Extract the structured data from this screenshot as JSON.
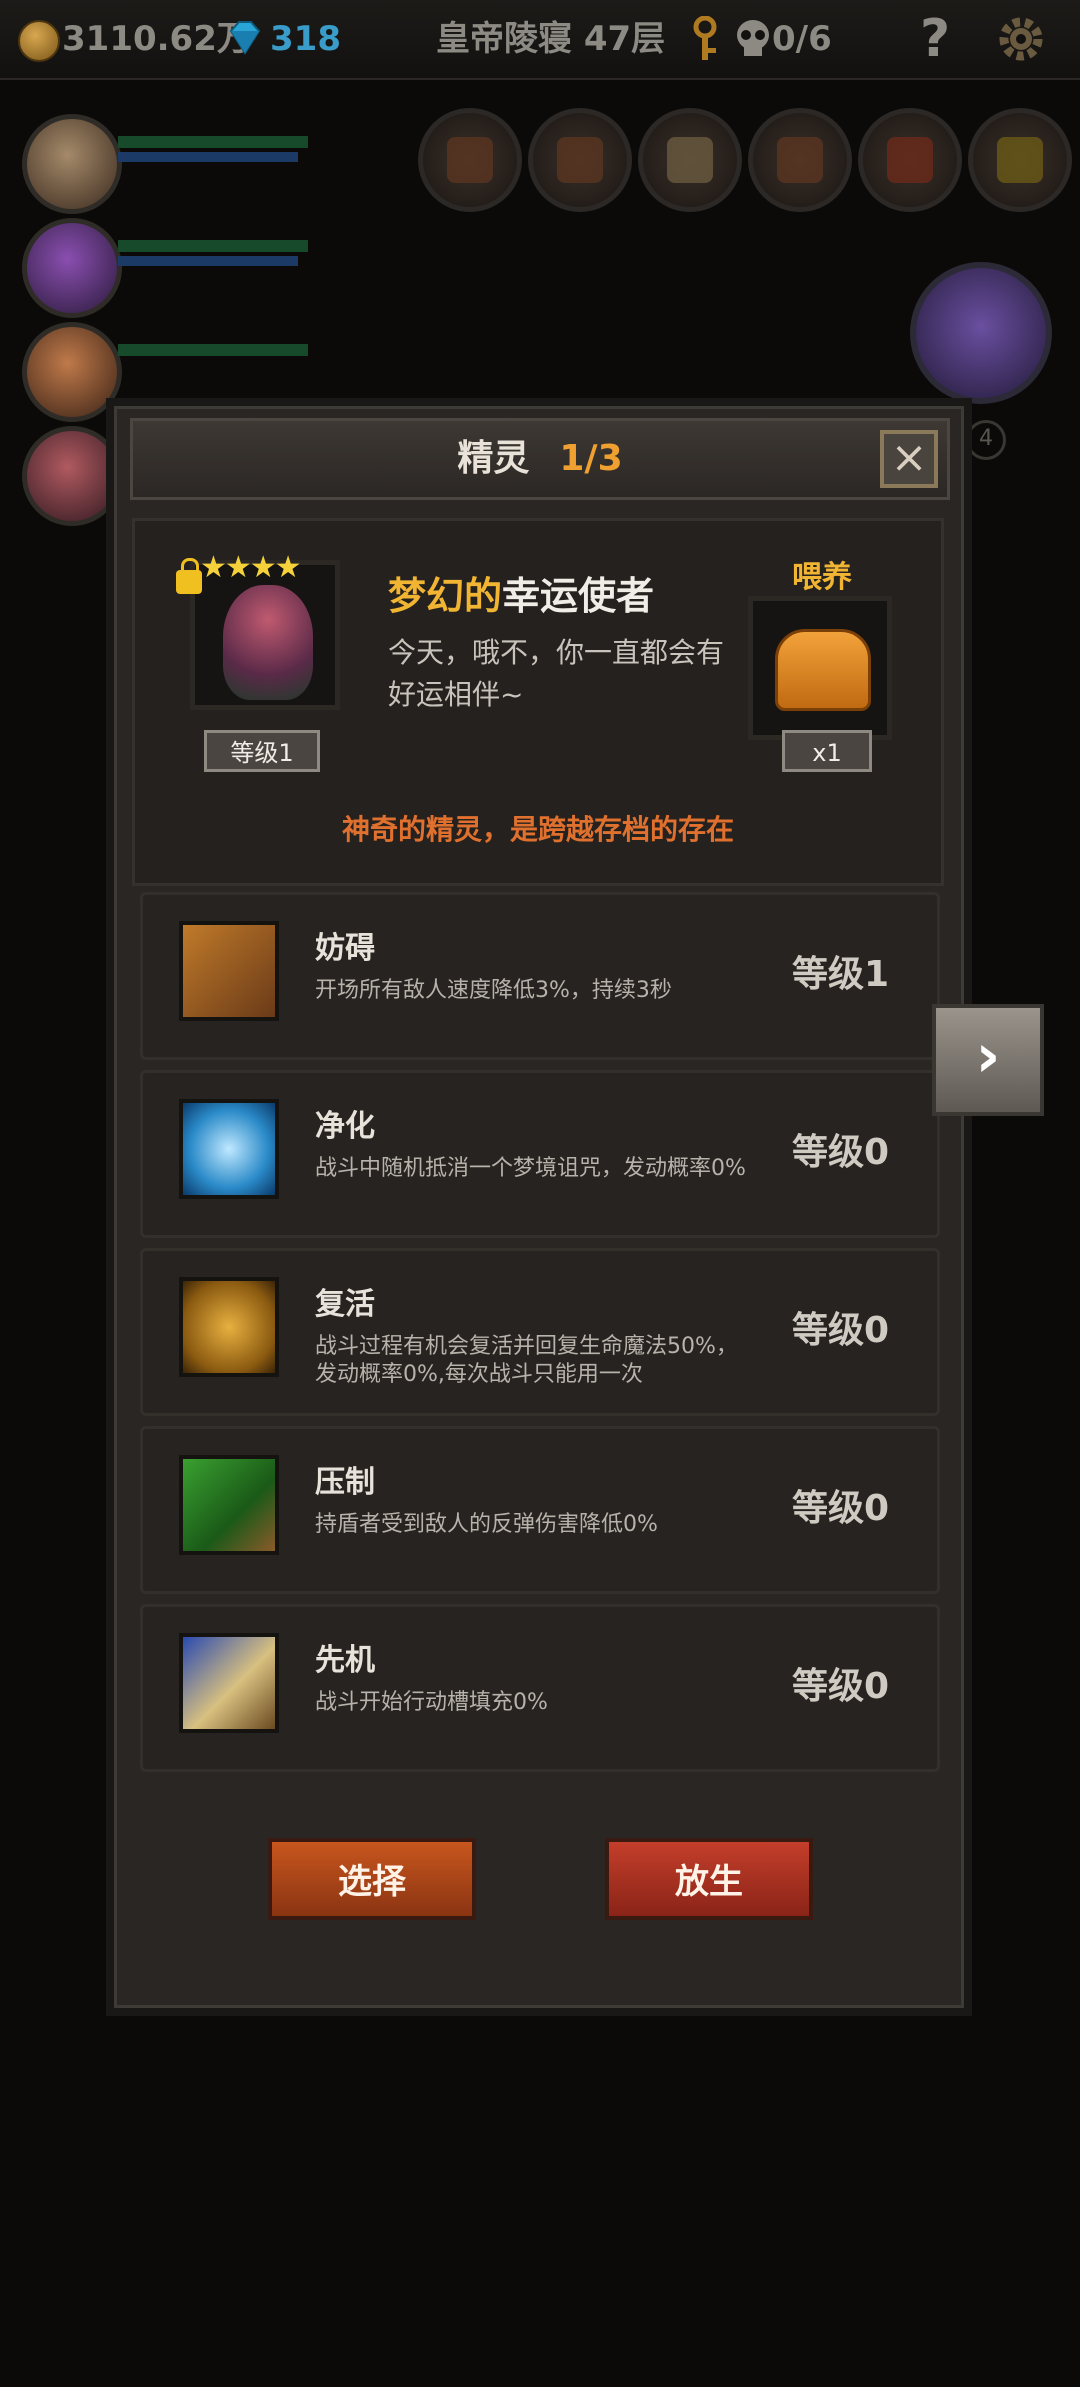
{
  "topbar": {
    "gold": "3110.62万",
    "gems": "318",
    "location": "皇帝陵寝 47层",
    "keys": "0/6",
    "help": "?"
  },
  "panel": {
    "title": "精灵",
    "page": "1/3",
    "close": "×",
    "sprite": {
      "name_part1": "梦幻的",
      "name_part2": "幸运使者",
      "stars": "★★★★",
      "description": "今天，哦不，你一直都会有好运相伴~",
      "level": "等级1",
      "feed_label": "喂养",
      "feed_count": "x1",
      "tagline": "神奇的精灵，是跨越存档的存在"
    },
    "skills": [
      {
        "name": "妨碍",
        "desc": "开场所有敌人速度降低3%，持续3秒",
        "level": "等级1"
      },
      {
        "name": "净化",
        "desc": "战斗中随机抵消一个梦境诅咒，发动概率0%",
        "level": "等级0"
      },
      {
        "name": "复活",
        "desc": "战斗过程有机会复活并回复生命魔法50%，发动概率0%,每次战斗只能用一次",
        "level": "等级0"
      },
      {
        "name": "压制",
        "desc": "持盾者受到敌人的反弹伤害降低0%",
        "level": "等级0"
      },
      {
        "name": "先机",
        "desc": "战斗开始行动槽填充0%",
        "level": "等级0"
      }
    ],
    "next_arrow": "›",
    "select_label": "选择",
    "release_label": "放生"
  },
  "background": {
    "boss_badge": "4"
  }
}
